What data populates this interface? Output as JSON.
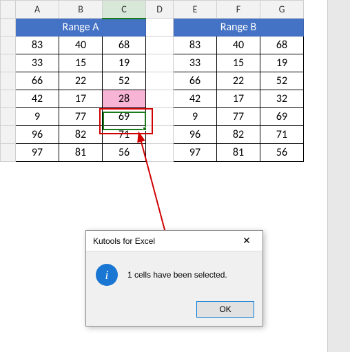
{
  "columns": [
    "A",
    "B",
    "C",
    "D",
    "E",
    "F",
    "G"
  ],
  "active_column": "C",
  "ranges": {
    "a": {
      "title": "Range A",
      "rows": [
        [
          83,
          40,
          68
        ],
        [
          33,
          15,
          19
        ],
        [
          66,
          22,
          52
        ],
        [
          42,
          17,
          28
        ],
        [
          9,
          77,
          69
        ],
        [
          96,
          82,
          71
        ],
        [
          97,
          81,
          56
        ]
      ]
    },
    "b": {
      "title": "Range B",
      "rows": [
        [
          83,
          40,
          68
        ],
        [
          33,
          15,
          19
        ],
        [
          66,
          22,
          52
        ],
        [
          42,
          17,
          32
        ],
        [
          9,
          77,
          69
        ],
        [
          96,
          82,
          71
        ],
        [
          97,
          81,
          56
        ]
      ]
    }
  },
  "highlighted_cell": {
    "col": "C",
    "row": 5,
    "value": 28
  },
  "dialog": {
    "title": "Kutools for Excel",
    "message": "1 cells have been selected.",
    "ok_label": "OK"
  }
}
